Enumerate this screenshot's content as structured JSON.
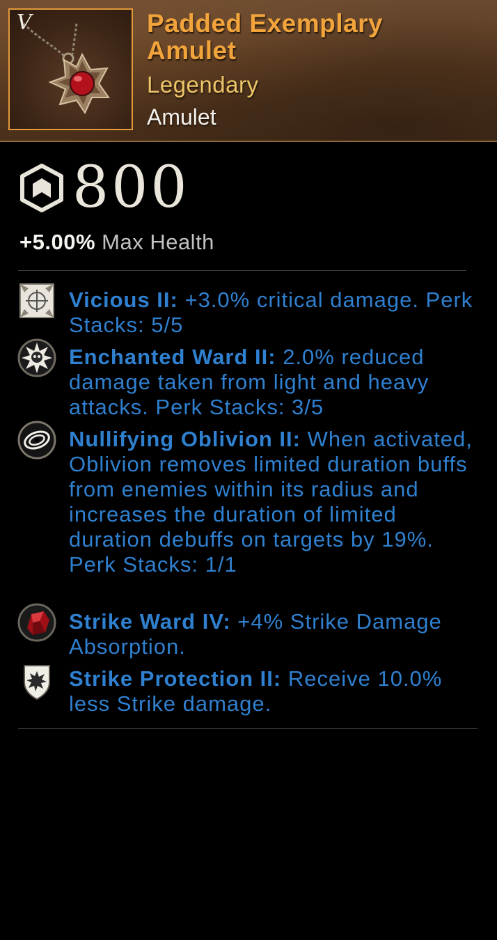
{
  "item": {
    "name": "Padded Exemplary Amulet",
    "rarity": "Legendary",
    "type": "Amulet",
    "tier": "V",
    "icon": "amulet-icon"
  },
  "gear_score": {
    "value": "800",
    "icon": "gear-score-icon"
  },
  "stat": {
    "value": "+5.00%",
    "label": "Max Health"
  },
  "perks": [
    {
      "name": "Vicious II:",
      "description": " +3.0% critical damage. Perk Stacks: 5/5",
      "icon": "crosshair-perk-icon"
    },
    {
      "name": "Enchanted Ward II:",
      "description": " 2.0% reduced damage taken from light and heavy attacks. Perk Stacks: 3/5",
      "icon": "skull-burst-perk-icon"
    },
    {
      "name": "Nullifying Oblivion II:",
      "description": " When activated, Oblivion removes limited duration buffs from enemies within its radius and increases the duration of limited duration debuffs on targets by 19%. Perk Stacks: 1/1",
      "icon": "vortex-perk-icon"
    },
    {
      "name": "Strike Ward IV:",
      "description": " +4% Strike Damage Absorption.",
      "icon": "ruby-gem-icon"
    },
    {
      "name": "Strike Protection II:",
      "description": " Receive 10.0% less Strike damage.",
      "icon": "shield-burst-perk-icon"
    }
  ],
  "colors": {
    "name": "#f2a43c",
    "rarity": "#ecc569",
    "perk_text": "#2f80cf",
    "frame": "#e39a3b",
    "background": "#000000"
  }
}
